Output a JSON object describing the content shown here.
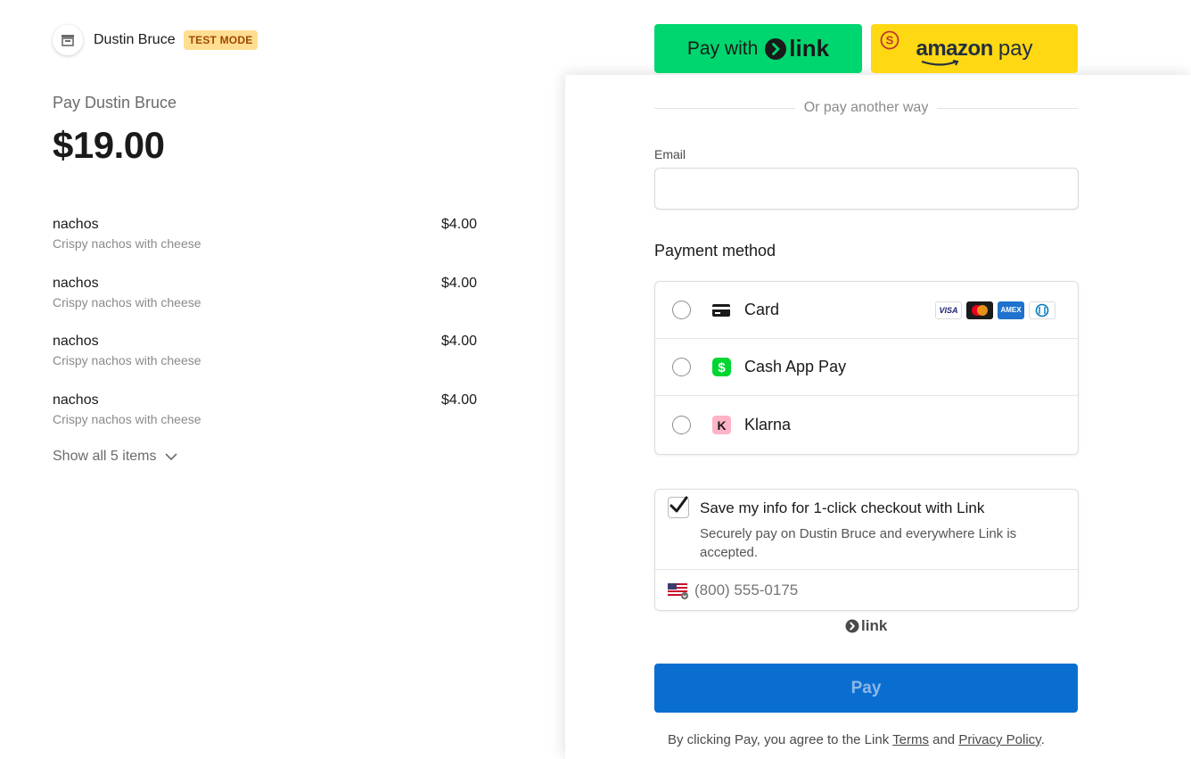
{
  "merchant": {
    "name": "Dustin Bruce",
    "badge": "TEST MODE"
  },
  "summary": {
    "pay_label": "Pay Dustin Bruce",
    "total": "$19.00"
  },
  "items": [
    {
      "name": "nachos",
      "description": "Crispy nachos with cheese",
      "price": "$4.00"
    },
    {
      "name": "nachos",
      "description": "Crispy nachos with cheese",
      "price": "$4.00"
    },
    {
      "name": "nachos",
      "description": "Crispy nachos with cheese",
      "price": "$4.00"
    },
    {
      "name": "nachos",
      "description": "Crispy nachos with cheese",
      "price": "$4.00"
    }
  ],
  "show_all_label": "Show all 5 items",
  "express": {
    "link_prefix": "Pay with",
    "link_word": "link",
    "amazon_word": "amazon",
    "amazon_pay": "pay"
  },
  "divider_text": "Or pay another way",
  "email": {
    "label": "Email",
    "value": ""
  },
  "payment_method": {
    "title": "Payment method",
    "options": [
      {
        "label": "Card",
        "icon": "card-icon",
        "selected": false
      },
      {
        "label": "Cash App Pay",
        "icon": "cash-app-icon",
        "selected": false
      },
      {
        "label": "Klarna",
        "icon": "klarna-icon",
        "selected": false
      }
    ],
    "card_brands": [
      "VISA",
      "mastercard",
      "AMEX",
      "diners"
    ]
  },
  "link_save": {
    "checked": true,
    "title": "Save my info for 1-click checkout with Link",
    "description": "Securely pay on Dustin Bruce and everywhere Link is accepted.",
    "phone_placeholder": "(800) 555-0175"
  },
  "link_mark": "link",
  "pay_button": "Pay",
  "terms": {
    "prefix": "By clicking Pay, you agree to the Link",
    "terms_link": "Terms",
    "and": "and",
    "privacy_link": "Privacy Policy",
    "suffix": "."
  },
  "colors": {
    "link_green": "#00d66f",
    "amazon_yellow": "#ffd814",
    "pay_blue": "#0a6ed1",
    "test_badge_bg": "#ffde92",
    "test_badge_text": "#a04a00"
  }
}
